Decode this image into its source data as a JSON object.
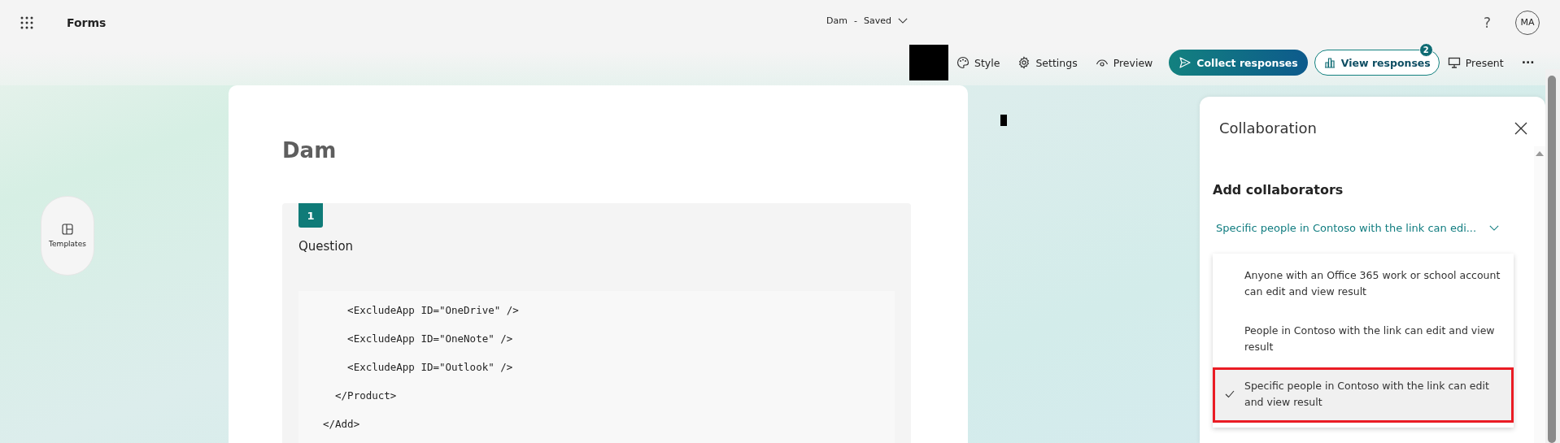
{
  "app": {
    "name": "Forms"
  },
  "document": {
    "title": "Dam",
    "separator": "-",
    "status": "Saved"
  },
  "account": {
    "help": "?",
    "initials": "MA"
  },
  "toolbar": [
    {
      "kind": "icon",
      "label": "Style"
    },
    {
      "kind": "icon",
      "label": "Settings"
    },
    {
      "kind": "icon",
      "label": "Preview"
    },
    {
      "kind": "primary",
      "label": "Collect responses"
    },
    {
      "kind": "outline",
      "label": "View responses",
      "badge": "2"
    },
    {
      "kind": "icon",
      "label": "Present"
    },
    {
      "kind": "more",
      "label": "···"
    }
  ],
  "sidebar": {
    "templates": "Templates"
  },
  "form": {
    "title": "Dam",
    "questions": [
      {
        "number": "1",
        "label": "Question",
        "code_lines": [
          "    <ExcludeApp ID=\"OneDrive\" />",
          "    <ExcludeApp ID=\"OneNote\" />",
          "    <ExcludeApp ID=\"Outlook\" />",
          "  </Product>",
          "</Add>"
        ]
      }
    ]
  },
  "panel": {
    "title": "Collaboration",
    "section": "Add collaborators",
    "dropdown": {
      "value": "Specific people in Contoso with the link can edi...",
      "expanded": true
    },
    "options": [
      {
        "label": "Anyone with an Office 365 work or school account can edit and view result",
        "selected": false,
        "highlighted": false
      },
      {
        "label": "People in Contoso with the link can edit and view result",
        "selected": false,
        "highlighted": false
      },
      {
        "label": "Specific people in Contoso with the link can edit and view result",
        "selected": true,
        "highlighted": true
      }
    ]
  }
}
